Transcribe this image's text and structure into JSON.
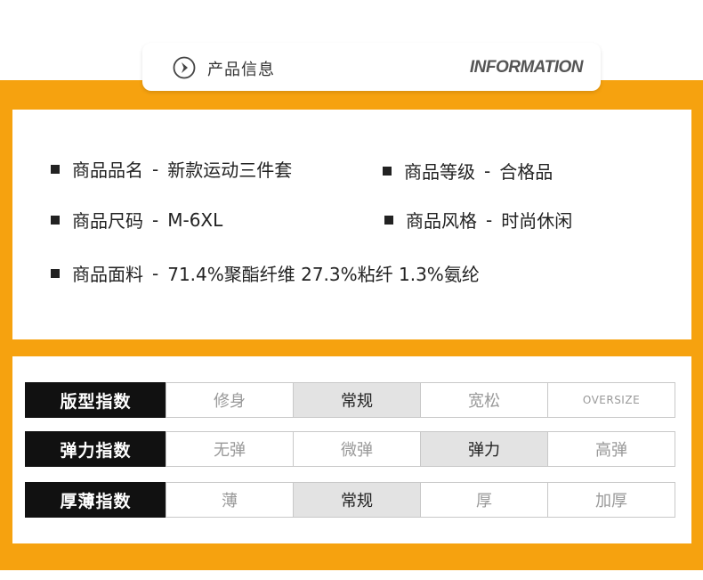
{
  "header": {
    "title": "产品信息",
    "subtitle_en": "INFORMATION",
    "icon": "chevron-circle-right-icon"
  },
  "info": {
    "separator": "-",
    "name": {
      "label": "商品品名",
      "value": "新款运动三件套"
    },
    "grade": {
      "label": "商品等级",
      "value": "合格品"
    },
    "size": {
      "label": "商品尺码",
      "value": "M-6XL"
    },
    "style": {
      "label": "商品风格",
      "value": "时尚休闲"
    },
    "fabric": {
      "label": "商品面料",
      "value": "71.4%聚酯纤维 27.3%粘纤 1.3%氨纶"
    }
  },
  "scales": [
    {
      "label": "版型指数",
      "options": [
        "修身",
        "常规",
        "宽松",
        "OVERSIZE"
      ],
      "selected": 1
    },
    {
      "label": "弹力指数",
      "options": [
        "无弹",
        "微弹",
        "弹力",
        "高弹"
      ],
      "selected": 2
    },
    {
      "label": "厚薄指数",
      "options": [
        "薄",
        "常规",
        "厚",
        "加厚"
      ],
      "selected": 1
    }
  ],
  "colors": {
    "accent": "#f6a20f",
    "label_bg": "#111111",
    "selected_bg": "#e3e3e3",
    "unselected_text": "#999999"
  }
}
